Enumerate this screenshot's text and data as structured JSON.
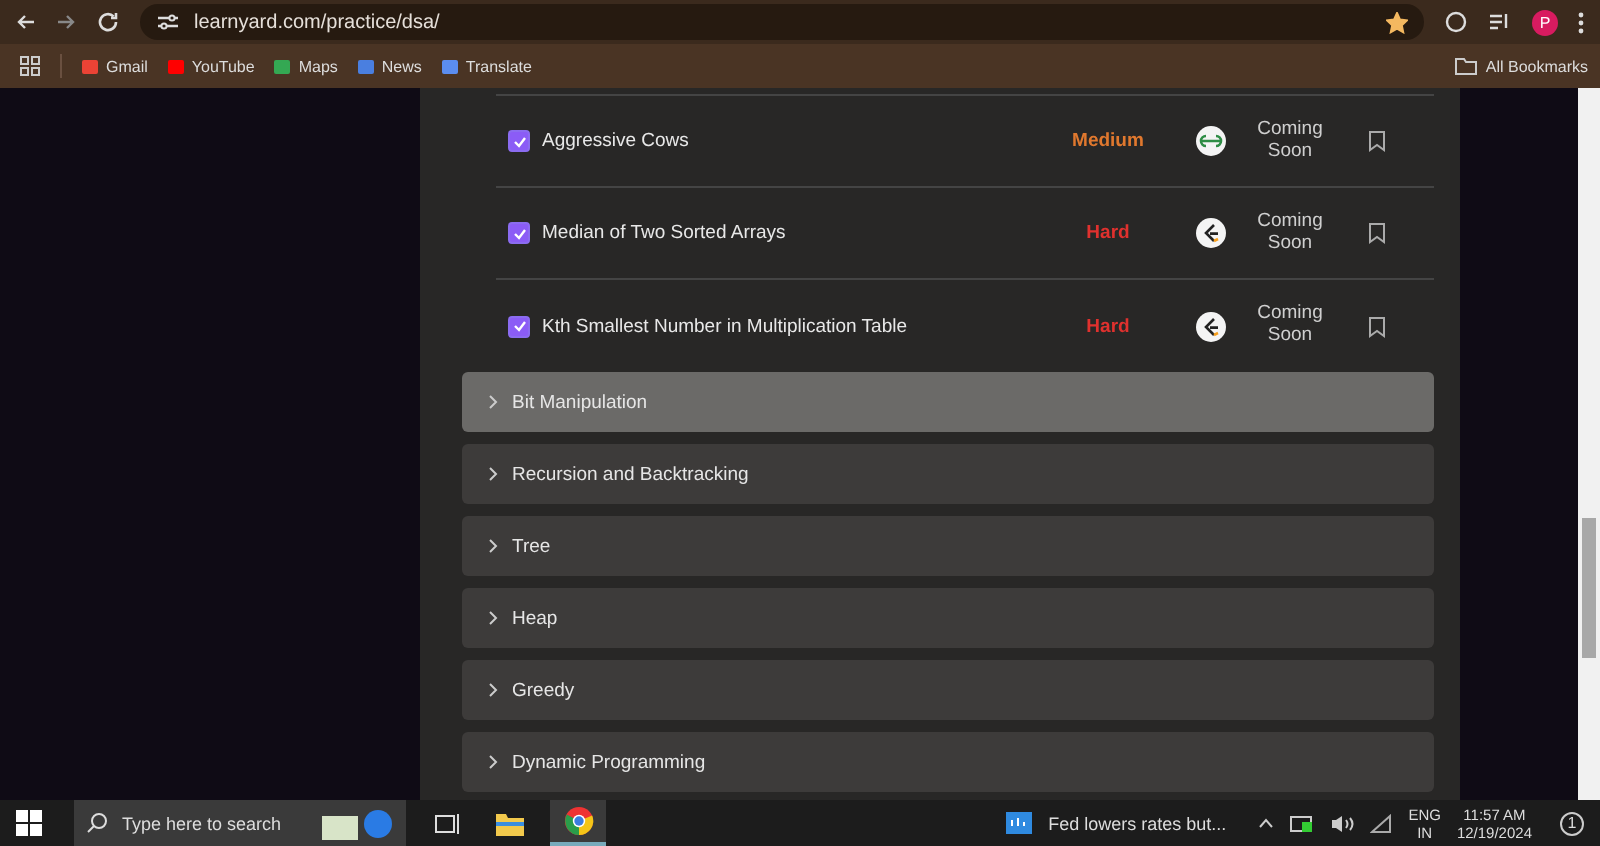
{
  "browser": {
    "url": "learnyard.com/practice/dsa/",
    "bookmarks": [
      {
        "label": "Gmail",
        "kind": "gmail"
      },
      {
        "label": "YouTube",
        "kind": "youtube"
      },
      {
        "label": "Maps",
        "kind": "maps"
      },
      {
        "label": "News",
        "kind": "news"
      },
      {
        "label": "Translate",
        "kind": "translate"
      }
    ],
    "all_bookmarks": "All Bookmarks",
    "profile_initial": "P",
    "starred": true
  },
  "problems": [
    {
      "title": "Aggressive Cows",
      "checked": true,
      "difficulty": "Medium",
      "color": "#e0782e",
      "kind": "gfg",
      "status": "Coming Soon"
    },
    {
      "title": "Median of Two Sorted Arrays",
      "checked": true,
      "difficulty": "Hard",
      "color": "#e0312e",
      "kind": "leetcode",
      "status": "Coming Soon"
    },
    {
      "title": "Kth Smallest Number in Multiplication Table",
      "checked": true,
      "difficulty": "Hard",
      "color": "#e0312e",
      "kind": "leetcode",
      "status": "Coming Soon"
    }
  ],
  "sections": [
    {
      "title": "Bit Manipulation",
      "selected": true
    },
    {
      "title": "Recursion and Backtracking",
      "selected": false
    },
    {
      "title": "Tree",
      "selected": false
    },
    {
      "title": "Heap",
      "selected": false
    },
    {
      "title": "Greedy",
      "selected": false
    },
    {
      "title": "Dynamic Programming",
      "selected": false
    }
  ],
  "taskbar": {
    "search_placeholder": "Type here to search",
    "news": "Fed lowers rates but...",
    "language": "ENG",
    "region": "IN",
    "time": "11:57 AM",
    "date": "12/19/2024",
    "notification_count": "1"
  }
}
